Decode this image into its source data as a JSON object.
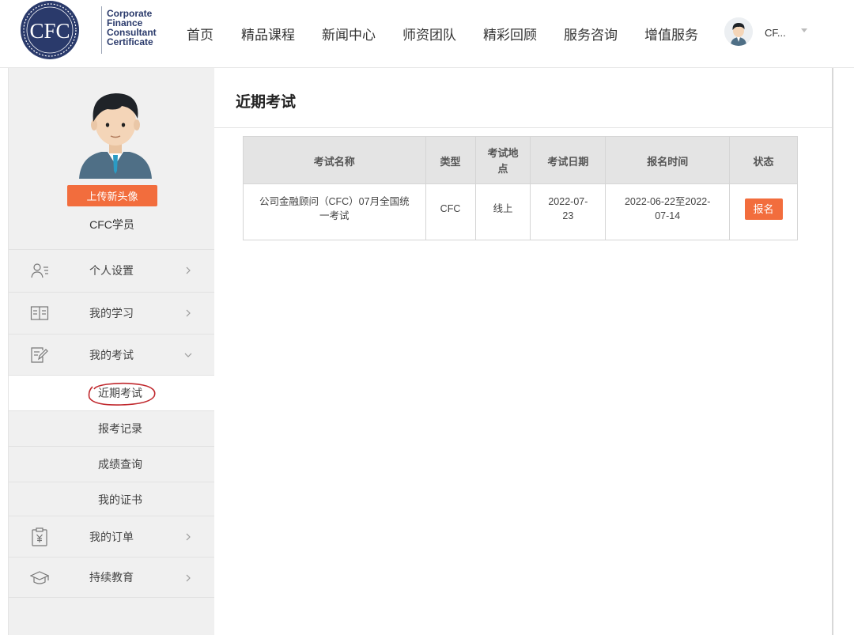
{
  "header": {
    "logo": {
      "emblem_text": "CFC",
      "line1": "Corporate",
      "line2": "Finance",
      "line3": "Consultant",
      "line4": "Certificate"
    },
    "nav": [
      {
        "label": "首页"
      },
      {
        "label": "精品课程"
      },
      {
        "label": "新闻中心"
      },
      {
        "label": "师资团队"
      },
      {
        "label": "精彩回顾"
      },
      {
        "label": "服务咨询"
      },
      {
        "label": "增值服务"
      }
    ],
    "user": {
      "name": "CF..."
    }
  },
  "sidebar": {
    "upload_label": "上传新头像",
    "profile_name": "CFC学员",
    "menu": [
      {
        "label": "个人设置",
        "icon": "user-list-icon"
      },
      {
        "label": "我的学习",
        "icon": "book-icon"
      },
      {
        "label": "我的考试",
        "icon": "edit-document-icon"
      },
      {
        "label": "我的订单",
        "icon": "yuan-clipboard-icon"
      },
      {
        "label": "持续教育",
        "icon": "graduation-cap-icon"
      }
    ],
    "exam_sub": [
      {
        "label": "近期考试"
      },
      {
        "label": "报考记录"
      },
      {
        "label": "成绩查询"
      },
      {
        "label": "我的证书"
      }
    ]
  },
  "main": {
    "title": "近期考试",
    "table": {
      "headers": [
        "考试名称",
        "类型",
        "考试地点",
        "考试日期",
        "报名时间",
        "状态"
      ],
      "rows": [
        {
          "name": "公司金融顾问（CFC）07月全国统一考试",
          "type": "CFC",
          "location": "线上",
          "date": "2022-07-23",
          "signup": "2022-06-22至2022-07-14",
          "status": "报名"
        }
      ]
    }
  },
  "colors": {
    "accent": "#f26d3d",
    "logo_navy": "#2a3a6b",
    "sidebar_bg": "#f0f0f0",
    "annotation_red": "#c0282d"
  }
}
